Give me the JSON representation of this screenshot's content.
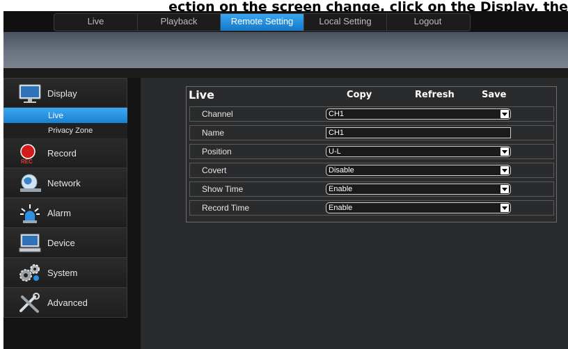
{
  "caption": "ection on the screen change, click on the Display, the",
  "topnav": {
    "tabs": [
      {
        "label": "Live"
      },
      {
        "label": "Playback"
      },
      {
        "label": "Remote Setting"
      },
      {
        "label": "Local Setting"
      },
      {
        "label": "Logout"
      }
    ],
    "active": "Remote Setting"
  },
  "sidebar": {
    "display": {
      "label": "Display",
      "icon": "monitor-icon"
    },
    "subitems": [
      {
        "label": "Live"
      },
      {
        "label": "Privacy Zone"
      }
    ],
    "selected_subitem": "Live",
    "record": {
      "label": "Record",
      "icon": "record-icon",
      "badge": "REC"
    },
    "network": {
      "label": "Network",
      "icon": "globe-network-icon"
    },
    "alarm": {
      "label": "Alarm",
      "icon": "alarm-siren-icon"
    },
    "device": {
      "label": "Device",
      "icon": "computer-icon"
    },
    "system": {
      "label": "System",
      "icon": "gears-icon"
    },
    "advanced": {
      "label": "Advanced",
      "icon": "tools-icon"
    }
  },
  "panel": {
    "title": "Live",
    "copy": "Copy",
    "refresh": "Refresh",
    "save": "Save",
    "rows": {
      "channel": {
        "label": "Channel",
        "value": "CH1"
      },
      "name": {
        "label": "Name",
        "value": "CH1"
      },
      "position": {
        "label": "Position",
        "value": "U-L"
      },
      "covert": {
        "label": "Covert",
        "value": "Disable"
      },
      "show_time": {
        "label": "Show Time",
        "value": "Enable"
      },
      "record_time": {
        "label": "Record Time",
        "value": "Enable"
      }
    }
  },
  "colors": {
    "accent": "#1f86d8",
    "background": "#141414",
    "content": "#2a2b2d"
  }
}
